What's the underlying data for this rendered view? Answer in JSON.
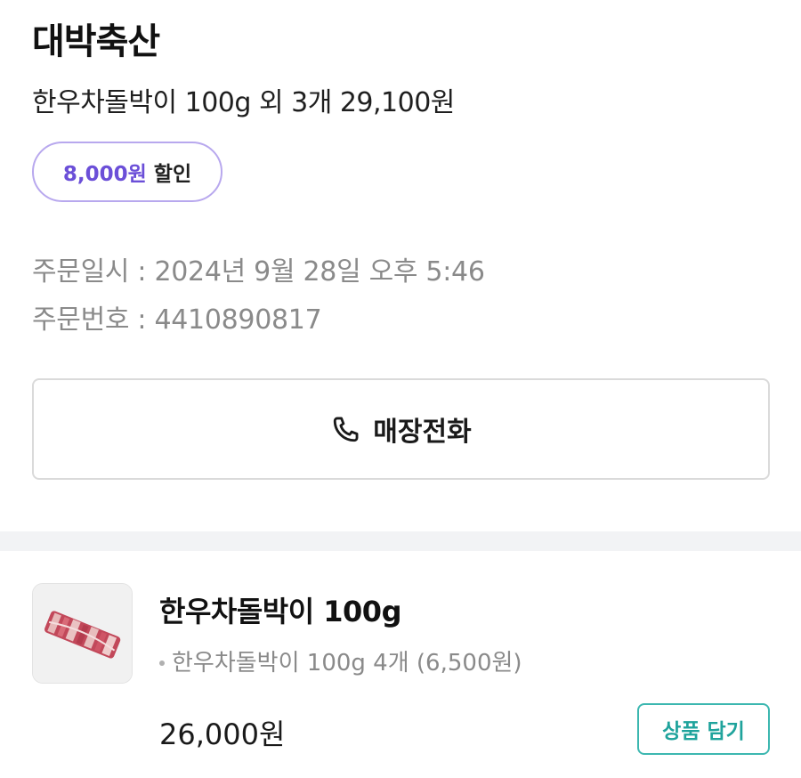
{
  "store": {
    "name": "대박축산"
  },
  "order": {
    "summary": "한우차돌박이 100g 외 3개 29,100원",
    "discount": {
      "amount": "8,000원",
      "suffix": "할인"
    },
    "date_label": "주문일시 : ",
    "date_value": "2024년 9월 28일 오후 5:46",
    "number_label": "주문번호 : ",
    "number_value": "4410890817"
  },
  "actions": {
    "call_store_label": "매장전화",
    "call_icon": "phone-icon"
  },
  "product": {
    "name": "한우차돌박이 100g",
    "option": "한우차돌박이 100g 4개 (6,500원)",
    "price": "26,000원",
    "add_to_cart_label": "상품 담기",
    "thumbnail_icon": "sliced-beef-image"
  },
  "colors": {
    "discount_accent": "#6b4fd8",
    "discount_border": "#b8a8ee",
    "cart_button": "#3cb7b0",
    "muted_text": "#8a8a8a",
    "divider_band": "#f2f3f5"
  }
}
